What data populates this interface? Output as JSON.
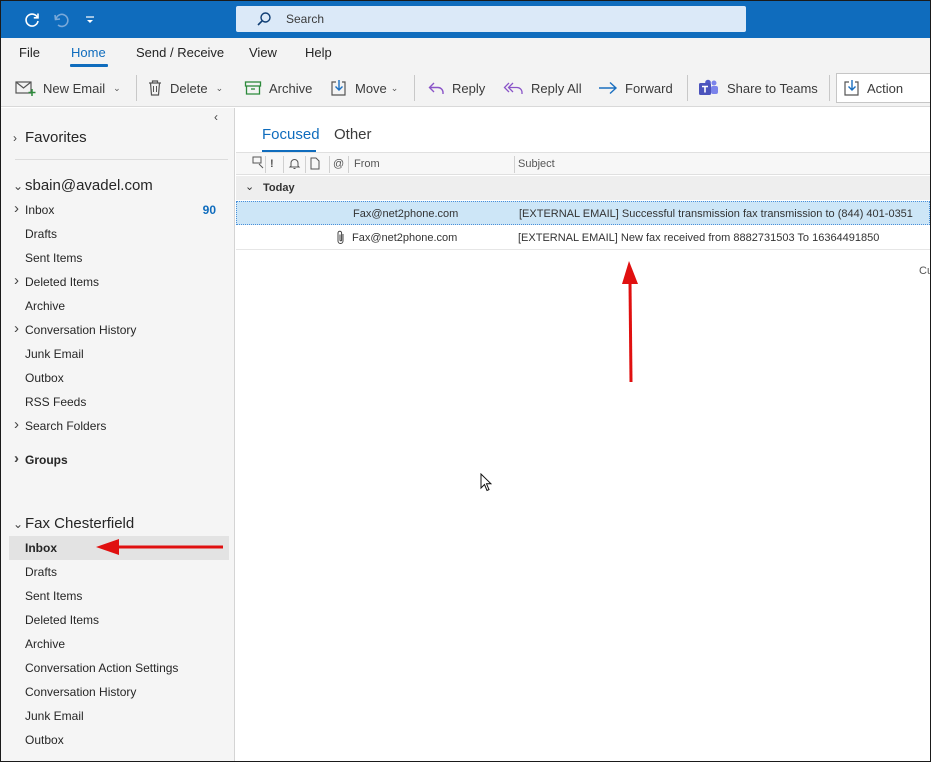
{
  "titlebar": {
    "search_placeholder": "Search",
    "icons": [
      "sync-icon",
      "undo-icon",
      "quick-access-icon",
      "search-icon"
    ]
  },
  "menu": {
    "tabs": [
      "File",
      "Home",
      "Send / Receive",
      "View",
      "Help"
    ],
    "active_tab": "Home"
  },
  "ribbon": {
    "new_email": "New Email",
    "delete": "Delete",
    "archive": "Archive",
    "move": "Move",
    "reply": "Reply",
    "reply_all": "Reply All",
    "forward": "Forward",
    "share_teams": "Share to Teams",
    "action": "Action"
  },
  "nav": {
    "favorites": "Favorites",
    "account1": {
      "name": "sbain@avadel.com",
      "items": [
        {
          "label": "Inbox",
          "count": "90"
        },
        {
          "label": "Drafts"
        },
        {
          "label": "Sent Items"
        },
        {
          "label": "Deleted Items"
        },
        {
          "label": "Archive"
        },
        {
          "label": "Conversation History"
        },
        {
          "label": "Junk Email"
        },
        {
          "label": "Outbox"
        },
        {
          "label": "RSS Feeds"
        },
        {
          "label": "Search Folders"
        }
      ]
    },
    "groups": "Groups",
    "account2": {
      "name": "Fax Chesterfield",
      "items": [
        {
          "label": "Inbox"
        },
        {
          "label": "Drafts"
        },
        {
          "label": "Sent Items"
        },
        {
          "label": "Deleted Items"
        },
        {
          "label": "Archive"
        },
        {
          "label": "Conversation Action Settings"
        },
        {
          "label": "Conversation History"
        },
        {
          "label": "Junk Email"
        },
        {
          "label": "Outbox"
        }
      ]
    }
  },
  "list": {
    "tabs": [
      "Focused",
      "Other"
    ],
    "columns": {
      "from": "From",
      "subject": "Subject",
      "importance": "!"
    },
    "group_label": "Today",
    "messages": [
      {
        "from": "Fax@net2phone.com",
        "subject": "[EXTERNAL EMAIL] Successful transmission fax transmission to (844) 401-0351",
        "attachment": false,
        "selected": true
      },
      {
        "from": "Fax@net2phone.com",
        "subject": "[EXTERNAL EMAIL] New fax received from 8882731503 To 16364491850",
        "attachment": true,
        "selected": false
      }
    ],
    "truncated_text": "Cu"
  },
  "colors": {
    "accent": "#0f6cbd",
    "annotation_arrow": "#e01010",
    "selection": "#cde6f7"
  }
}
